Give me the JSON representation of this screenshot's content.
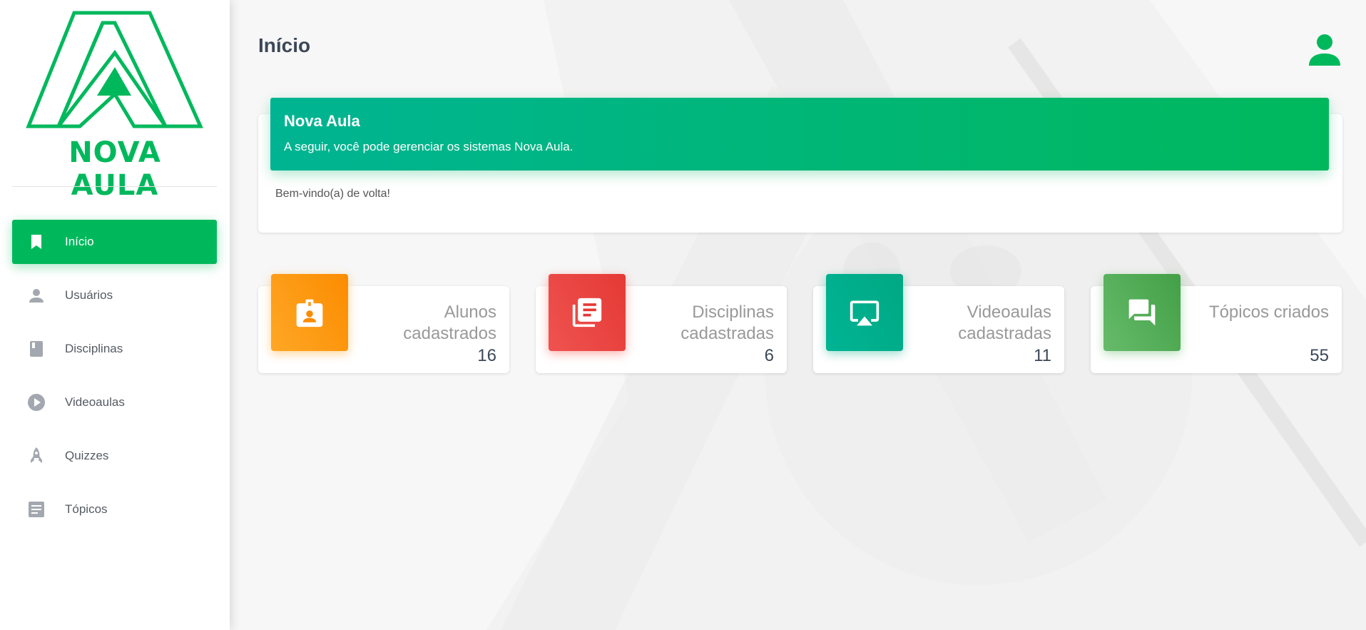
{
  "brand": {
    "name": "NOVA AULA",
    "color": "#00b85c"
  },
  "sidebar": {
    "items": [
      {
        "label": "Início",
        "icon": "bookmark-icon",
        "active": true
      },
      {
        "label": "Usuários",
        "icon": "person-icon",
        "active": false
      },
      {
        "label": "Disciplinas",
        "icon": "book-icon",
        "active": false
      },
      {
        "label": "Videoaulas",
        "icon": "play-circle-icon",
        "active": false
      },
      {
        "label": "Quizzes",
        "icon": "rocket-icon",
        "active": false
      },
      {
        "label": "Tópicos",
        "icon": "article-icon",
        "active": false
      }
    ]
  },
  "header": {
    "title": "Início",
    "user_icon": "account-icon"
  },
  "welcome": {
    "title": "Nova Aula",
    "subtitle": "A seguir, você pode gerenciar os sistemas Nova Aula.",
    "body": "Bem-vindo(a) de volta!"
  },
  "stats": [
    {
      "label": "Alunos cadastrados",
      "value": "16",
      "icon": "badge-icon",
      "color": "#fb8c00"
    },
    {
      "label": "Disciplinas cadastradas",
      "value": "6",
      "icon": "library-books-icon",
      "color": "#e53935"
    },
    {
      "label": "Videoaulas cadastradas",
      "value": "11",
      "icon": "airplay-icon",
      "color": "#00a884"
    },
    {
      "label": "Tópicos criados",
      "value": "55",
      "icon": "forum-icon",
      "color": "#43a047"
    }
  ]
}
